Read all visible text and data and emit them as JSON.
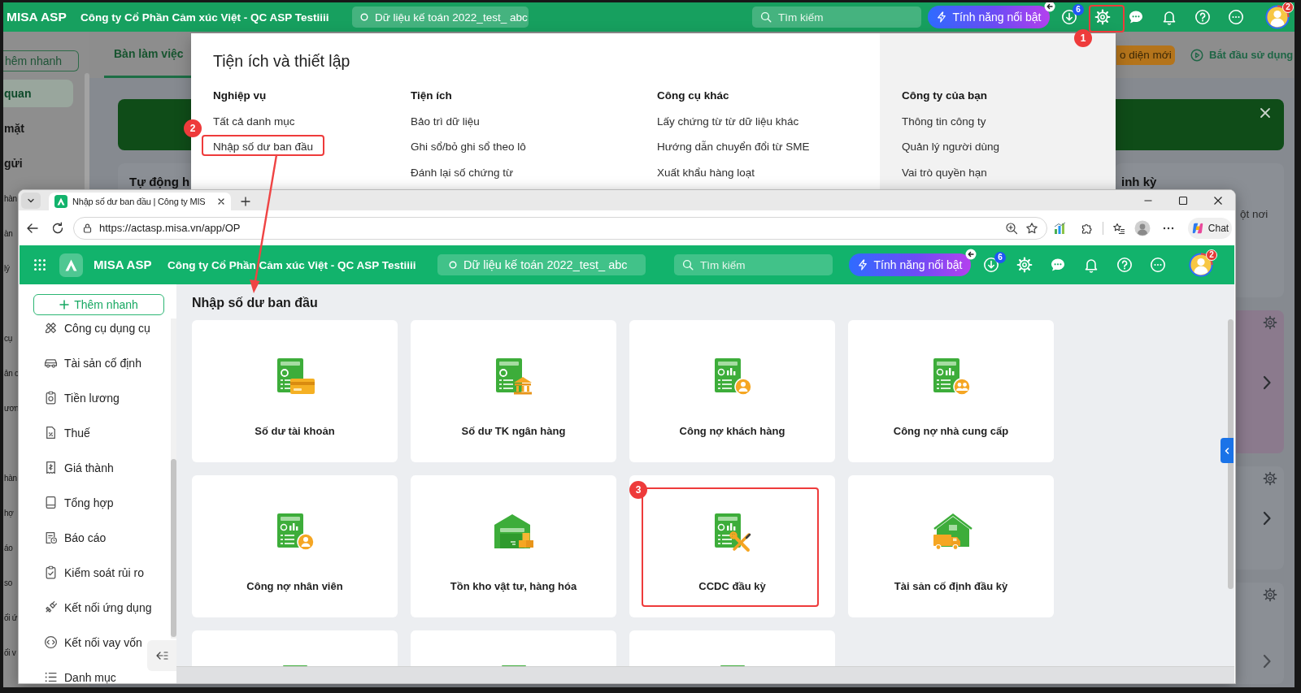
{
  "background_app": {
    "header": {
      "logo": "MISA ASP",
      "company": "Công ty Cổ Phần Cảm xúc Việt - QC ASP Testiiii",
      "dataset": "Dữ liệu kế toán 2022_test_ abc",
      "search": {
        "placeholder": "Tìm kiếm"
      },
      "feature_button": "Tính năng nổi bật",
      "download_badge": "6",
      "avatar_badge": "2"
    },
    "sidebar": {
      "quick_add": "hêm nhanh",
      "groups": [
        [
          {
            "label": "quan",
            "selected": true
          },
          {
            "label": "mặt",
            "selected": false
          },
          {
            "label": "gửi",
            "selected": false
          },
          {
            "label": "hàn",
            "selected": false
          },
          {
            "label": "àn",
            "selected": false
          },
          {
            "label": "lý",
            "selected": false
          }
        ],
        [
          {
            "label": "cụ",
            "selected": false
          },
          {
            "label": "ản c",
            "selected": false
          },
          {
            "label": "ươn",
            "selected": false
          }
        ],
        [
          {
            "label": "hàn",
            "selected": false
          },
          {
            "label": "hợ",
            "selected": false
          },
          {
            "label": "áo",
            "selected": false
          },
          {
            "label": "so",
            "selected": false
          },
          {
            "label": "ối ứ",
            "selected": false
          },
          {
            "label": "ối v",
            "selected": false
          }
        ]
      ]
    },
    "tabs": [
      {
        "label": "Bàn làm việc",
        "selected": true
      }
    ],
    "new_ui_button": "o diện mới",
    "start_button": "Bắt đầu sử dụng",
    "cards": [
      {
        "title": "Tự động h"
      },
      {
        "title": "inh kỳ",
        "text": "ột nơi"
      }
    ]
  },
  "settings_menu": {
    "title": "Tiện ích và thiết lập",
    "columns": [
      {
        "heading": "Nghiệp vụ",
        "items": [
          "Tất cả danh mục",
          "Nhập số dư ban đầu"
        ]
      },
      {
        "heading": "Tiện ích",
        "items": [
          "Bảo trì dữ liệu",
          "Ghi sổ/bỏ ghi sổ theo lô",
          "Đánh lại số chứng từ"
        ]
      },
      {
        "heading": "Công cụ khác",
        "items": [
          "Lấy chứng từ từ dữ liệu khác",
          "Hướng dẫn chuyển đổi từ SME",
          "Xuất khẩu hàng loạt"
        ]
      },
      {
        "heading": "Công ty của bạn",
        "items": [
          "Thông tin công ty",
          "Quản lý người dùng",
          "Vai trò quyền hạn"
        ]
      }
    ]
  },
  "browser": {
    "tab_title": "Nhập số dư ban đầu | Công ty MIS",
    "url": "https://actasp.misa.vn/app/OP",
    "chat_button": "Chat",
    "app_header": {
      "logo": "MISA ASP",
      "company": "Công ty Cổ Phần Cảm xúc Việt - QC ASP Testiiii",
      "dataset": "Dữ liệu kế toán 2022_test_ abc",
      "search": {
        "placeholder": "Tìm kiếm"
      },
      "feature_button": "Tính năng nổi bật",
      "download_badge": "6",
      "avatar_badge": "2"
    },
    "sidebar": {
      "quick_add": "Thêm nhanh",
      "items": [
        {
          "label": "Công cụ dụng cụ",
          "kind": "tools"
        },
        {
          "label": "Tài sản cố định",
          "kind": "car"
        },
        {
          "label": "Tiền lương",
          "kind": "payroll"
        },
        {
          "label": "Thuế",
          "kind": "tax"
        },
        {
          "label": "Giá thành",
          "kind": "cost"
        },
        {
          "label": "Tổng hợp",
          "kind": "ledger"
        },
        {
          "label": "Báo cáo",
          "kind": "report"
        },
        {
          "label": "Kiểm soát rủi ro",
          "kind": "risk"
        },
        {
          "label": "Kết nối ứng dụng",
          "kind": "plug"
        },
        {
          "label": "Kết nối vay vốn",
          "kind": "loan"
        },
        {
          "label": "Danh mục",
          "kind": "list"
        }
      ]
    },
    "page_title": "Nhập số dư ban đầu",
    "cards": [
      {
        "label": "Số dư tài khoản",
        "kind": "account"
      },
      {
        "label": "Số dư TK ngân hàng",
        "kind": "bank"
      },
      {
        "label": "Công nợ khách hàng",
        "kind": "customer"
      },
      {
        "label": "Công nợ nhà cung cấp",
        "kind": "supplier"
      },
      {
        "label": "Công nợ nhân viên",
        "kind": "employee"
      },
      {
        "label": "Tồn kho vật tư, hàng hóa",
        "kind": "inventory"
      },
      {
        "label": "CCDC đầu kỳ",
        "kind": "tools"
      },
      {
        "label": "Tài sản cố định đầu kỳ",
        "kind": "asset"
      },
      {
        "kind": "cut"
      },
      {
        "kind": "cut"
      },
      {
        "kind": "cut"
      }
    ]
  },
  "annotations": [
    {
      "number": "1"
    },
    {
      "number": "2"
    },
    {
      "number": "3"
    }
  ]
}
